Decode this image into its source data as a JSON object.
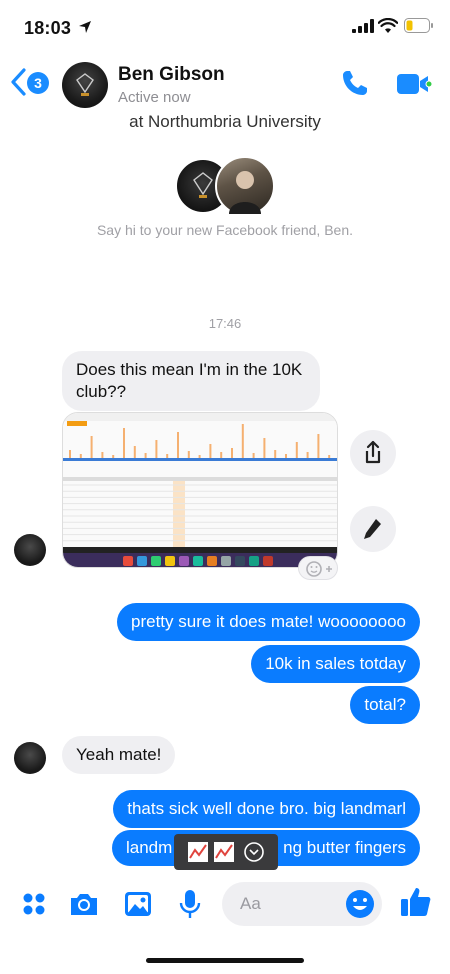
{
  "status_bar": {
    "time": "18:03"
  },
  "header": {
    "back_count": "3",
    "name": "Ben Gibson",
    "status": "Active now"
  },
  "intro": {
    "subtitle": "at Northumbria University",
    "say_hi": "Say hi to your new Facebook friend, Ben."
  },
  "thread": {
    "timestamp": "17:46",
    "messages": [
      {
        "dir": "in",
        "text": "Does this mean I'm in the 10K club??"
      },
      {
        "dir": "in",
        "type": "image",
        "text": ""
      },
      {
        "dir": "out",
        "text": "pretty sure it does mate! woooooooo"
      },
      {
        "dir": "out",
        "text": "10k in sales totday"
      },
      {
        "dir": "out",
        "text": "total?"
      },
      {
        "dir": "in",
        "text": "Yeah mate!"
      },
      {
        "dir": "out",
        "text": "thats sick well done bro. big landmarl"
      },
      {
        "dir": "out",
        "text_left": "landm",
        "text_right": "ng butter fingers"
      }
    ]
  },
  "composer": {
    "placeholder": "Aa"
  },
  "colors": {
    "accent": "#0a7cff",
    "incoming_bubble": "#efeff2",
    "active_dot": "#31cc46"
  },
  "icons": [
    "location-arrow-icon",
    "signal-icon",
    "wifi-icon",
    "battery-icon",
    "back-chevron-icon",
    "phone-icon",
    "video-camera-icon",
    "share-icon",
    "pencil-icon",
    "add-reaction-icon",
    "menu-dots-icon",
    "camera-icon",
    "gallery-icon",
    "microphone-icon",
    "emoji-icon",
    "thumbs-up-icon",
    "chart-emoji-icon",
    "chevron-down-circle-icon"
  ]
}
